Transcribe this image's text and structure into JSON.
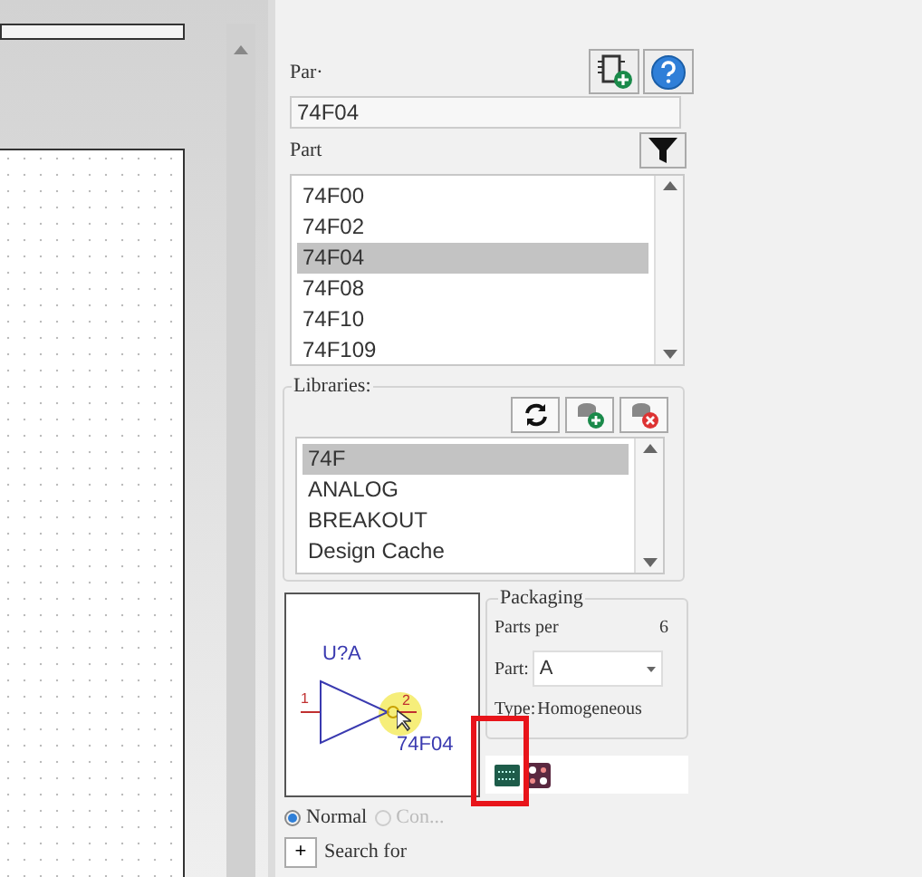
{
  "part_field": {
    "label": "Par·",
    "value": "74F04"
  },
  "parts": {
    "label": "Part",
    "items": [
      {
        "label": "74F00",
        "selected": false
      },
      {
        "label": "74F02",
        "selected": false
      },
      {
        "label": "74F04",
        "selected": true
      },
      {
        "label": "74F08",
        "selected": false
      },
      {
        "label": "74F10",
        "selected": false
      },
      {
        "label": "74F109",
        "selected": false
      }
    ]
  },
  "libraries": {
    "label": "Libraries:",
    "items": [
      {
        "label": "74F",
        "selected": true
      },
      {
        "label": "ANALOG",
        "selected": false
      },
      {
        "label": "BREAKOUT",
        "selected": false
      },
      {
        "label": "Design Cache",
        "selected": false
      }
    ]
  },
  "preview": {
    "reference": "U?A",
    "pin_in": "1",
    "pin_out": "2",
    "value": "74F04"
  },
  "packaging": {
    "title": "Packaging",
    "parts_per_label": "Parts per",
    "parts_per_value": "6",
    "part_label": "Part:",
    "part_value": "A",
    "type_label": "Type:",
    "type_value": "Homogeneous"
  },
  "view_options": [
    {
      "label": "Normal",
      "selected": true,
      "disabled": false
    },
    {
      "label": "Con...",
      "selected": false,
      "disabled": true
    }
  ],
  "search": {
    "button": "+",
    "label": "Search for"
  }
}
